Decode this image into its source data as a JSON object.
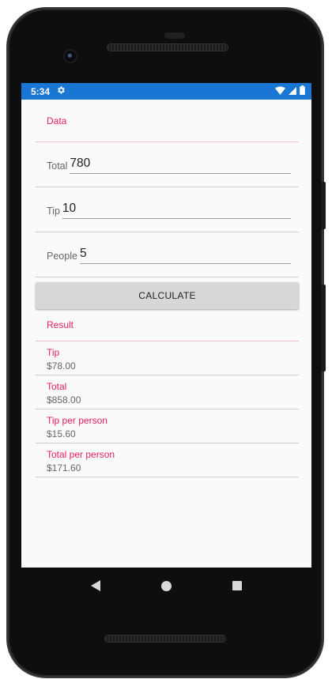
{
  "status_bar": {
    "time": "5:34",
    "icons": [
      "gear-icon",
      "wifi-icon",
      "cell-signal-icon",
      "battery-icon"
    ]
  },
  "data_section": {
    "title": "Data",
    "total_label": "Total",
    "total_value": "780",
    "tip_label": "Tip",
    "tip_value": "10",
    "people_label": "People",
    "people_value": "5",
    "calculate_label": "CALCULATE"
  },
  "result_section": {
    "title": "Result",
    "items": [
      {
        "label": "Tip",
        "value": "$78.00"
      },
      {
        "label": "Total",
        "value": "$858.00"
      },
      {
        "label": "Tip per person",
        "value": "$15.60"
      },
      {
        "label": "Total per person",
        "value": "$171.60"
      }
    ]
  },
  "navigation_bar": {
    "icons": [
      "back-icon",
      "home-icon",
      "recents-icon"
    ]
  },
  "colors": {
    "status_bar": "#1976d2",
    "accent": "#e91e63",
    "button": "#d6d7d7",
    "screen_background": "#fafafa"
  }
}
